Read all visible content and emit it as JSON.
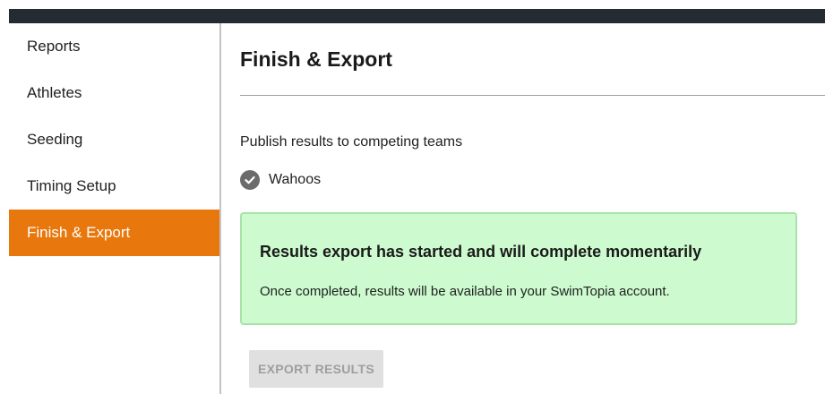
{
  "sidebar": {
    "items": [
      {
        "label": "Reports"
      },
      {
        "label": "Athletes"
      },
      {
        "label": "Seeding"
      },
      {
        "label": "Timing Setup"
      },
      {
        "label": "Finish & Export",
        "active": true
      }
    ]
  },
  "main": {
    "title": "Finish & Export",
    "publish_label": "Publish results to competing teams",
    "teams": [
      {
        "name": "Wahoos",
        "icon": "check-circle-icon",
        "checked": true
      }
    ],
    "alert": {
      "title": "Results export has started and will complete momentarily",
      "body": "Once completed, results will be available in your SwimTopia account."
    },
    "export_button_label": "EXPORT RESULTS",
    "export_button_disabled": true
  },
  "colors": {
    "topbar": "#252b33",
    "accent": "#e8780e",
    "alert_bg": "#cdfbcf",
    "alert_border": "#a6e3a8"
  }
}
